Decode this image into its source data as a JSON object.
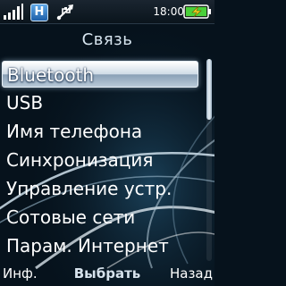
{
  "status_bar": {
    "time": "18:00",
    "network_badge": "H",
    "icons": [
      "signal-icon",
      "hspa-icon",
      "usb-icon",
      "battery-charging-icon"
    ]
  },
  "title": "Связь",
  "menu": {
    "items": [
      {
        "label": "Bluetooth",
        "selected": true
      },
      {
        "label": "USB"
      },
      {
        "label": "Имя телефона"
      },
      {
        "label": "Синхронизация"
      },
      {
        "label": "Управление устр."
      },
      {
        "label": "Сотовые сети"
      },
      {
        "label": "Парам. Интернет"
      }
    ]
  },
  "softkeys": {
    "left": "Инф.",
    "center": "Выбрать",
    "right": "Назад"
  },
  "colors": {
    "background": "#06121c",
    "selection": "#cfdbe6",
    "battery_bolt": "#f0d020",
    "battery_fill": "#4ad03a"
  }
}
